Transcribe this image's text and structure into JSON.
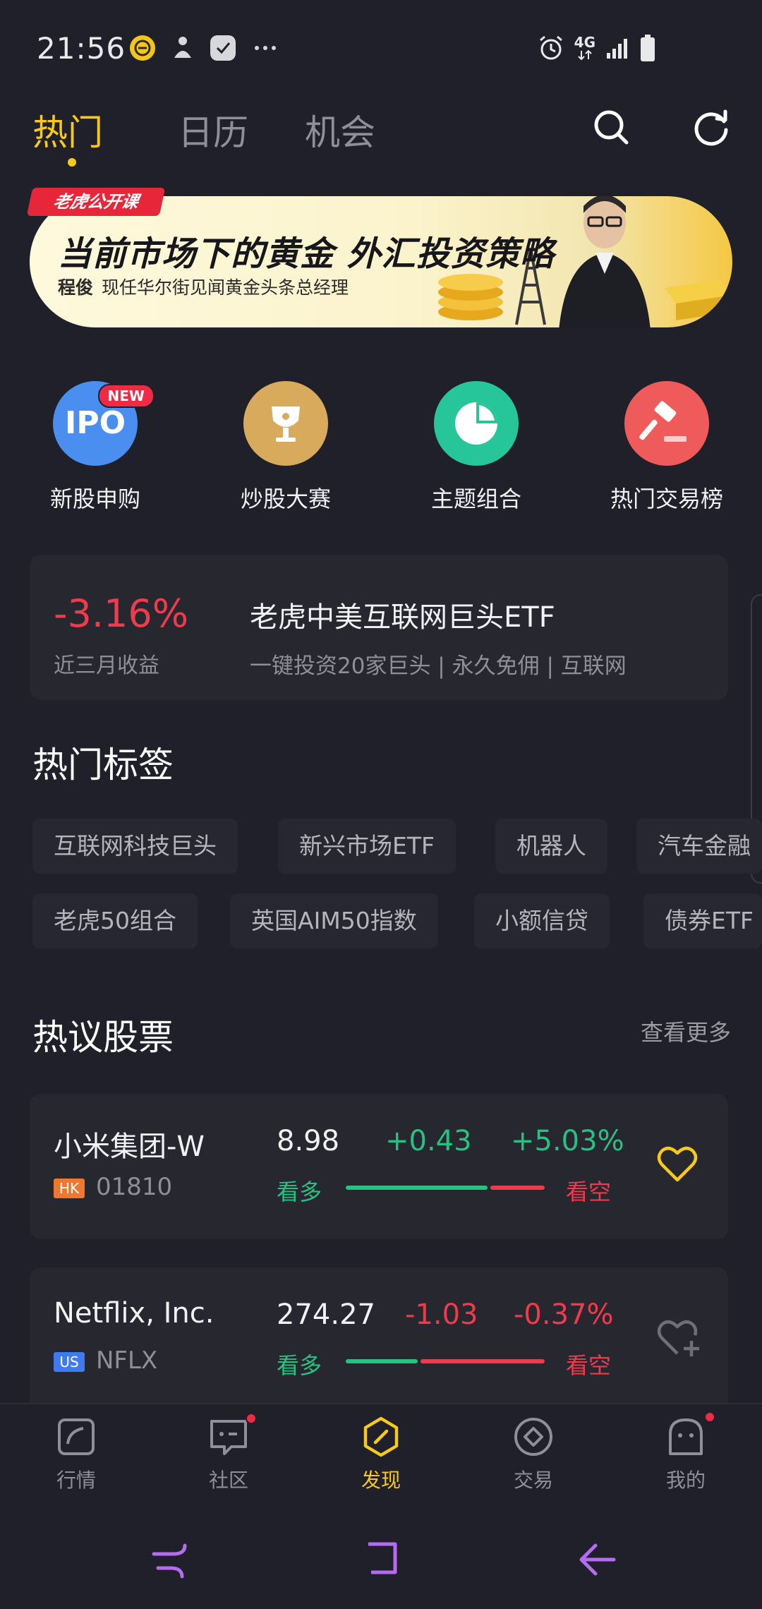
{
  "status_bar": {
    "time": "21:56",
    "network": "4G",
    "icons_left": [
      "coin-app-icon",
      "person-icon",
      "chat-app-icon",
      "more-dots-icon"
    ],
    "icons_right": [
      "alarm-icon",
      "network-4g-icon",
      "signal-icon",
      "battery-icon"
    ]
  },
  "top_tabs": [
    {
      "label": "热门",
      "active": true
    },
    {
      "label": "日历",
      "active": false
    },
    {
      "label": "机会",
      "active": false
    }
  ],
  "banner": {
    "tag": "老虎公开课",
    "title": "当前市场下的黄金 外汇投资策略",
    "speaker": "程俊",
    "speaker_desc": "现任华尔街见闻黄金头条总经理"
  },
  "quick_links": [
    {
      "label": "新股申购",
      "icon": "ipo-icon",
      "icon_text": "IPO",
      "badge": "NEW",
      "color": "#4a8ef0"
    },
    {
      "label": "炒股大赛",
      "icon": "trophy-icon",
      "color": "#d7aa5c"
    },
    {
      "label": "主题组合",
      "icon": "pie-chart-icon",
      "color": "#26c59a"
    },
    {
      "label": "热门交易榜",
      "icon": "gavel-icon",
      "color": "#ef5b5b"
    }
  ],
  "etf_card": {
    "return_pct": "-3.16%",
    "return_label": "近三月收益",
    "name": "老虎中美互联网巨头ETF",
    "desc": "一键投资20家巨头 | 永久免佣 | 互联网"
  },
  "hot_tags": {
    "title": "热门标签",
    "row1": [
      "互联网科技巨头",
      "新兴市场ETF",
      "机器人",
      "汽车金融"
    ],
    "row2": [
      "老虎50组合",
      "英国AIM50指数",
      "小额信贷",
      "债券ETF"
    ]
  },
  "hot_stocks": {
    "title": "热议股票",
    "more": "查看更多",
    "bull_label": "看多",
    "bear_label": "看空",
    "items": [
      {
        "name": "小米集团-W",
        "market": "HK",
        "code": "01810",
        "price": "8.98",
        "change": "+0.43",
        "change_pct": "+5.03%",
        "direction": "up",
        "bull_ratio": 0.72,
        "watched": true
      },
      {
        "name": "Netflix, Inc.",
        "market": "US",
        "code": "NFLX",
        "price": "274.27",
        "change": "-1.03",
        "change_pct": "-0.37%",
        "direction": "down",
        "bull_ratio": 0.37,
        "watched": false
      }
    ]
  },
  "bottom_nav": [
    {
      "label": "行情",
      "icon": "market-icon",
      "active": false,
      "dot": false
    },
    {
      "label": "社区",
      "icon": "community-icon",
      "active": false,
      "dot": true
    },
    {
      "label": "发现",
      "icon": "discover-icon",
      "active": true,
      "dot": false
    },
    {
      "label": "交易",
      "icon": "trade-icon",
      "active": false,
      "dot": false
    },
    {
      "label": "我的",
      "icon": "profile-icon",
      "active": false,
      "dot": true
    }
  ],
  "colors": {
    "accent": "#f7c919",
    "up": "#26c281",
    "down": "#ee3b4e",
    "background": "#1f2029",
    "card": "#26272f"
  }
}
